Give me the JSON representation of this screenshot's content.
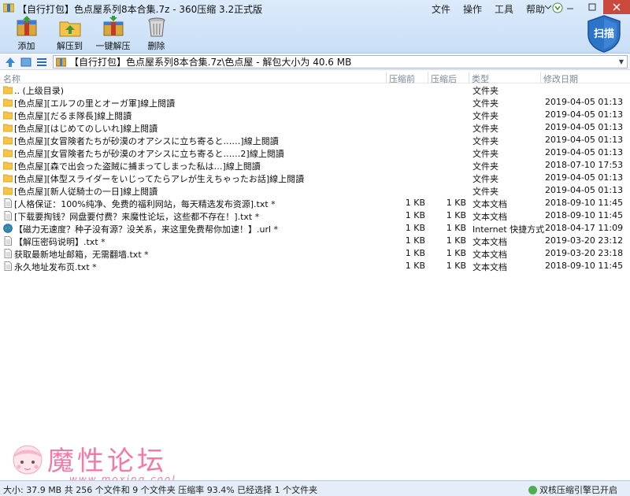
{
  "window": {
    "title": "【自行打包】色点屋系列8本合集.7z - 360压缩 3.2正式版",
    "menu": [
      "文件",
      "操作",
      "工具",
      "帮助"
    ]
  },
  "toolbar": {
    "items": [
      {
        "label": "添加",
        "icon": "add-archive-icon"
      },
      {
        "label": "解压到",
        "icon": "extract-to-icon"
      },
      {
        "label": "一键解压",
        "icon": "one-click-extract-icon"
      },
      {
        "label": "删除",
        "icon": "trash-icon"
      }
    ],
    "scan_label": "扫描"
  },
  "address": {
    "path": "【自行打包】色点屋系列8本合集.7z\\色点屋 - 解包大小为 40.6 MB"
  },
  "columns": {
    "name": "名称",
    "size": "压缩前",
    "csize": "压缩后",
    "type": "类型",
    "date": "修改日期"
  },
  "files": [
    {
      "name": ".. (上级目录)",
      "size": "",
      "csize": "",
      "type": "文件夹",
      "date": "",
      "icon": "folder"
    },
    {
      "name": "[色点屋][エルフの里とオーガ軍]線上閱讀",
      "size": "",
      "csize": "",
      "type": "文件夹",
      "date": "2019-04-05 01:13",
      "icon": "folder"
    },
    {
      "name": "[色点屋][だるま隊長]線上閱讀",
      "size": "",
      "csize": "",
      "type": "文件夹",
      "date": "2019-04-05 01:13",
      "icon": "folder"
    },
    {
      "name": "[色点屋][はじめてのしいれ]線上閱讀",
      "size": "",
      "csize": "",
      "type": "文件夹",
      "date": "2019-04-05 01:13",
      "icon": "folder"
    },
    {
      "name": "[色点屋][女冒険者たちが砂漠のオアシスに立ち寄ると……]線上閱讀",
      "size": "",
      "csize": "",
      "type": "文件夹",
      "date": "2019-04-05 01:13",
      "icon": "folder"
    },
    {
      "name": "[色点屋][女冒険者たちが砂漠のオアシスに立ち寄ると……2]線上閱讀",
      "size": "",
      "csize": "",
      "type": "文件夹",
      "date": "2019-04-05 01:13",
      "icon": "folder"
    },
    {
      "name": "[色点屋][森で出会った盗賊に捕まってしまった私は…]線上閱讀",
      "size": "",
      "csize": "",
      "type": "文件夹",
      "date": "2018-07-10 17:53",
      "icon": "folder"
    },
    {
      "name": "[色点屋][体型スライダーをいじってたらアレが生えちゃったお話]線上閱讀",
      "size": "",
      "csize": "",
      "type": "文件夹",
      "date": "2019-04-05 01:13",
      "icon": "folder"
    },
    {
      "name": "[色点屋][新人従騎士の一日]線上閱讀",
      "size": "",
      "csize": "",
      "type": "文件夹",
      "date": "2019-04-05 01:13",
      "icon": "folder"
    },
    {
      "name": "[人格保证：100%纯净、免费的福利网站，每天精选发布资源].txt *",
      "size": "1 KB",
      "csize": "1 KB",
      "type": "文本文档",
      "date": "2018-09-10 11:45",
      "icon": "text"
    },
    {
      "name": "[下载要掏钱？网盘要付费？来魔性论坛，这些都不存在！].txt *",
      "size": "1 KB",
      "csize": "1 KB",
      "type": "文本文档",
      "date": "2018-09-10 11:45",
      "icon": "text"
    },
    {
      "name": "【磁力无速度？种子没有源？没关系，来这里免费帮你加速！】.url *",
      "size": "1 KB",
      "csize": "1 KB",
      "type": "Internet 快捷方式",
      "date": "2018-04-17 11:09",
      "icon": "url"
    },
    {
      "name": "【解压密码说明】.txt *",
      "size": "1 KB",
      "csize": "1 KB",
      "type": "文本文档",
      "date": "2019-03-20 23:12",
      "icon": "text"
    },
    {
      "name": "获取最新地址邮箱，无需翻墙.txt *",
      "size": "1 KB",
      "csize": "1 KB",
      "type": "文本文档",
      "date": "2019-03-20 23:18",
      "icon": "text"
    },
    {
      "name": "永久地址发布页.txt *",
      "size": "1 KB",
      "csize": "1 KB",
      "type": "文本文档",
      "date": "2018-09-10 11:45",
      "icon": "text"
    }
  ],
  "watermark": {
    "title": "魔性论坛",
    "url": "www.moxing.cool"
  },
  "status": {
    "summary": "大小: 37.9 MB 共 256 个文件和 9 个文件夹 压缩率 93.4% 已经选择 1 个文件夹",
    "right": "双核压缩引擎已开启"
  },
  "colors": {
    "topbar": "#c9def6",
    "folder": "#f4c542",
    "accent": "#2c74c8"
  }
}
